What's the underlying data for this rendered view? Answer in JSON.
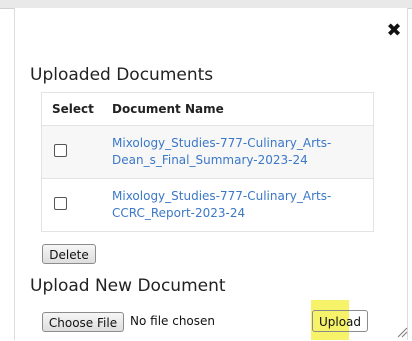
{
  "dialog": {
    "close_glyph": "✖",
    "uploaded_title": "Uploaded Documents",
    "upload_new_title": "Upload New Document"
  },
  "table": {
    "headers": [
      "Select",
      "Document Name"
    ],
    "rows": [
      {
        "checked": false,
        "name_line1": "Mixology_Studies-777-Culinary_Arts-",
        "name_line2": "Dean_s_Final_Summary-2023-24"
      },
      {
        "checked": false,
        "name_line1": "Mixology_Studies-777-Culinary_Arts-",
        "name_line2": "CCRC_Report-2023-24"
      }
    ]
  },
  "buttons": {
    "delete": "Delete",
    "choose_file": "Choose File",
    "upload": "Upload"
  },
  "file_input": {
    "status": "No file chosen"
  },
  "colors": {
    "link": "#3b78c7",
    "highlight": "#f5f050"
  }
}
